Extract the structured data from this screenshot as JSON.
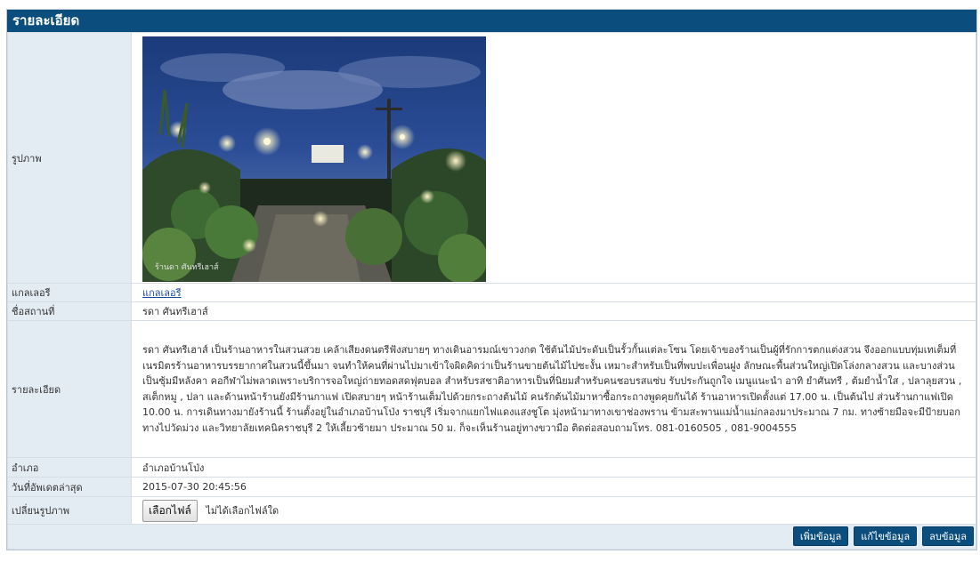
{
  "panel": {
    "title": "รายละเอียด"
  },
  "rows": {
    "photo_label": "รูปภาพ",
    "photo_caption": "ร้านดา ศันทรีเฮาส์",
    "gallery_label": "แกลเลอรี",
    "gallery_link": "แกลเลอรี",
    "place_label": "ชื่อสถานที่",
    "place_value": "รดา ศันทรีเฮาส์",
    "detail_label": "รายละเอียด",
    "detail_value": "รดา ศันทรีเฮาส์ เป็นร้านอาหารในสวนสวย เคล้าเสียงดนตรีฟังสบายๆ ทางเดินอารมณ์เขาวงกต ใช้ต้นไม้ประดับเป็นรั้วกั้นแต่ละโซน โดยเจ้าของร้านเป็นผู้ที่รักการตกแต่งสวน จึงออกแบบทุ่มเทเต็มที่เนรมิตรร้านอาหารบรรยากาศในสวนนี้ขึ้นมา จนทำให้คนที่ผ่านไปมาเข้าใจผิดคิดว่าเป็นร้านขายต้นไม้ไปซะงั้น เหมาะสำหรับเป็นที่พบปะเพื่อนฝูง ลักษณะพื้นส่วนใหญ่เปิดโล่งกลางสวน และบางส่วนเป็นซุ้มมีหลังคา คอกีฬาไม่พลาดเพราะบริการจอใหญ่ถ่ายทอดสดฟุตบอล สำหรับรสชาติอาหารเป็นที่นิยมสำหรับคนชอบรสแซ่บ รับประกันถูกใจ เมนูแนะนำ อาทิ ยำศันทรี , ต้มยำน้ำใส , ปลาลุยสวน , สเต็กหมู , ปลา และด้านหน้าร้านยังมีร้านกาแฟ เปิดสบายๆ หน้าร้านเต็มไปด้วยกระถางต้นไม้ คนรักต้นไม้มาหาซื้อกระถางพูดคุยกันได้ ร้านอาหารเปิดตั้งแต่ 17.00 น. เป็นต้นไป ส่วนร้านกาแฟเปิด 10.00 น. การเดินทางมายังร้านนี้ ร้านตั้งอยู่ในอำเภอบ้านโป่ง ราชบุรี เริ่มจากแยกไฟแดงแสงชูโต มุ่งหน้ามาทางเขาช่องพราน ข้ามสะพานแม่น้ำแม่กลองมาประมาณ 7 กม. ทางซ้ายมือจะมีป้ายบอกทางไปวัดม่วง และวิทยาลัยเทคนิคราชบุรี 2 ให้เลี้ยวซ้ายมา ประมาณ 50 ม. ก็จะเห็นร้านอยู่ทางขวามือ ติดต่อสอบถามโทร. 081-0160505 , 081-9004555",
    "district_label": "อำเภอ",
    "district_value": "อำเภอบ้านโป่ง",
    "updated_label": "วันที่อัพเดตล่าสุด",
    "updated_value": "2015-07-30 20:45:56",
    "change_label": "เปลี่ยนรูปภาพ",
    "file_button": "เลือกไฟล์",
    "file_status": "ไม่ได้เลือกไฟล์ใด"
  },
  "footer": {
    "add_button": "เพิ่มข้อมูล",
    "edit_button": "แก้ไขข้อมูล",
    "delete_button": "ลบข้อมูล"
  },
  "colors": {
    "header": "#0b4e7d",
    "label_bg": "#e3ebf3",
    "link": "#1a4da1"
  }
}
